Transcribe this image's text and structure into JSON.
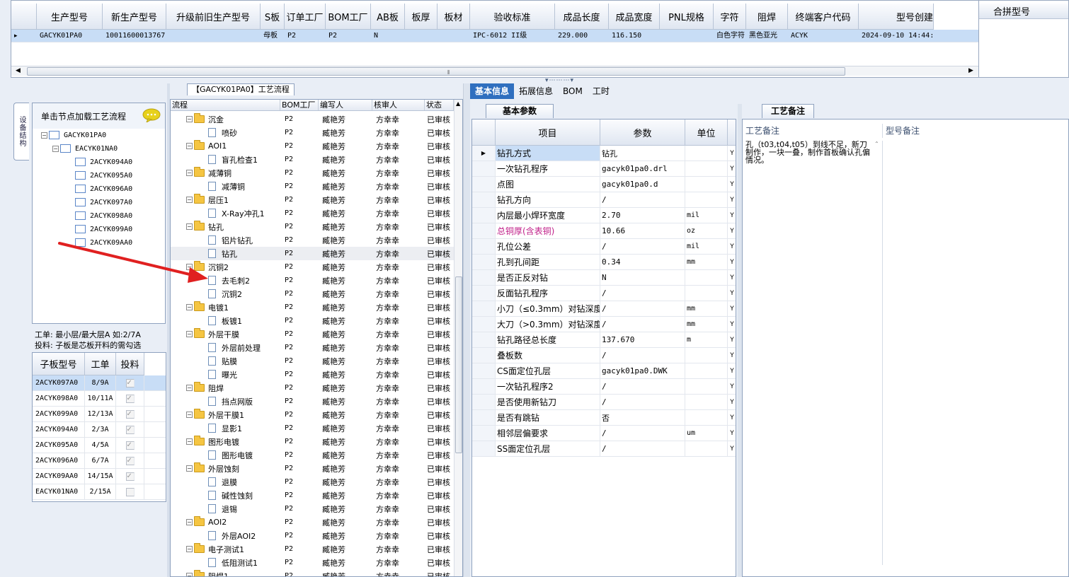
{
  "top_grid": {
    "columns": [
      "生产型号",
      "新生产型号",
      "升级前旧生产型号",
      "S板",
      "订单工厂",
      "BOM工厂",
      "AB板",
      "板厚",
      "板材",
      "验收标准",
      "成品长度",
      "成品宽度",
      "PNL规格",
      "字符",
      "阻焊",
      "终端客户代码",
      "型号创建"
    ],
    "row": [
      "GACYK01PA0",
      "10011600013767",
      "",
      "母板",
      "P2",
      "P2",
      "N",
      "",
      "",
      "IPC-6012 II级",
      "229.000",
      "116.150",
      "",
      "白色字符",
      "黑色亚光",
      "ACYK",
      "2024-09-10 14:44:"
    ],
    "merge_header": "合拼型号"
  },
  "left_panel": {
    "side_tab": "设备结构",
    "tree_hint": "单击节点加载工艺流程",
    "tree": {
      "root": "GACYK01PA0",
      "child": "EACYK01NA0",
      "leaves": [
        "2ACYK094A0",
        "2ACYK095A0",
        "2ACYK096A0",
        "2ACYK097A0",
        "2ACYK098A0",
        "2ACYK099A0",
        "2ACYK09AA0"
      ]
    },
    "note_line1": "工单: 最小层/最大层A 如:2/7A",
    "note_line2": "投料: 子板是芯板开料的需勾选",
    "sub_grid": {
      "headers": [
        "子板型号",
        "工单",
        "投料"
      ],
      "rows": [
        {
          "model": "2ACYK097A0",
          "order": "8/9A",
          "checked": true
        },
        {
          "model": "2ACYK098A0",
          "order": "10/11A",
          "checked": true
        },
        {
          "model": "2ACYK099A0",
          "order": "12/13A",
          "checked": true
        },
        {
          "model": "2ACYK094A0",
          "order": "2/3A",
          "checked": true
        },
        {
          "model": "2ACYK095A0",
          "order": "4/5A",
          "checked": true
        },
        {
          "model": "2ACYK096A0",
          "order": "6/7A",
          "checked": true
        },
        {
          "model": "2ACYK09AA0",
          "order": "14/15A",
          "checked": true
        },
        {
          "model": "EACYK01NA0",
          "order": "2/15A",
          "checked": false
        }
      ],
      "check_glyph": "✓"
    }
  },
  "flow_panel": {
    "title": "【GACYK01PA0】工艺流程",
    "headers": [
      "流程",
      "BOM工厂",
      "编写人",
      "核审人",
      "状态"
    ],
    "bom": "P2",
    "writer": "臧艳芳",
    "reviewer": "方幸幸",
    "status": "已审核",
    "rows": [
      {
        "t": "f",
        "n": "沉金"
      },
      {
        "t": "d",
        "n": "喷砂"
      },
      {
        "t": "f",
        "n": "AOI1"
      },
      {
        "t": "d",
        "n": "盲孔检查1"
      },
      {
        "t": "f",
        "n": "减薄铜"
      },
      {
        "t": "d",
        "n": "减薄铜"
      },
      {
        "t": "f",
        "n": "层压1"
      },
      {
        "t": "d",
        "n": "X-Ray冲孔1"
      },
      {
        "t": "f",
        "n": "钻孔"
      },
      {
        "t": "d",
        "n": "铝片钻孔"
      },
      {
        "t": "d",
        "n": "钻孔",
        "sel": true
      },
      {
        "t": "f",
        "n": "沉铜2"
      },
      {
        "t": "d",
        "n": "去毛刺2"
      },
      {
        "t": "d",
        "n": "沉铜2"
      },
      {
        "t": "f",
        "n": "电镀1"
      },
      {
        "t": "d",
        "n": "板镀1"
      },
      {
        "t": "f",
        "n": "外层干膜"
      },
      {
        "t": "d",
        "n": "外层前处理"
      },
      {
        "t": "d",
        "n": "贴膜"
      },
      {
        "t": "d",
        "n": "曝光"
      },
      {
        "t": "f",
        "n": "阻焊"
      },
      {
        "t": "d",
        "n": "挡点网版"
      },
      {
        "t": "f",
        "n": "外层干膜1"
      },
      {
        "t": "d",
        "n": "显影1"
      },
      {
        "t": "f",
        "n": "图形电镀"
      },
      {
        "t": "d",
        "n": "图形电镀"
      },
      {
        "t": "f",
        "n": "外层蚀刻"
      },
      {
        "t": "d",
        "n": "退膜"
      },
      {
        "t": "d",
        "n": "碱性蚀刻"
      },
      {
        "t": "d",
        "n": "退锡"
      },
      {
        "t": "f",
        "n": "AOI2"
      },
      {
        "t": "d",
        "n": "外层AOI2"
      },
      {
        "t": "f",
        "n": "电子测试1"
      },
      {
        "t": "d",
        "n": "低阻测试1"
      },
      {
        "t": "f",
        "n": "阻焊1"
      }
    ]
  },
  "right_panel": {
    "tabs": [
      "基本信息",
      "拓展信息",
      "BOM",
      "工时"
    ],
    "active_tab": "基本信息",
    "sub_tab": "基本参数",
    "param_headers": [
      "项目",
      "参数",
      "单位"
    ],
    "params": [
      {
        "name": "钻孔方式",
        "value": "钻孔",
        "unit": "",
        "hl": true
      },
      {
        "name": "一次钻孔程序",
        "value": "gacyk01pa0.drl",
        "unit": ""
      },
      {
        "name": "点图",
        "value": "gacyk01pa0.d",
        "unit": ""
      },
      {
        "name": "钻孔方向",
        "value": "/",
        "unit": ""
      },
      {
        "name": "内层最小焊环宽度",
        "value": "2.70",
        "unit": "mil"
      },
      {
        "name": "总铜厚(含表铜)",
        "value": "10.66",
        "unit": "oz",
        "pink": true
      },
      {
        "name": "孔位公差",
        "value": "/",
        "unit": "mil"
      },
      {
        "name": "孔到孔间距",
        "value": "0.34",
        "unit": "mm"
      },
      {
        "name": "是否正反对钻",
        "value": "N",
        "unit": ""
      },
      {
        "name": "反面钻孔程序",
        "value": "/",
        "unit": ""
      },
      {
        "name": "小刀（≤0.3mm）对钻深度",
        "value": "/",
        "unit": "mm"
      },
      {
        "name": "大刀（>0.3mm）对钻深度",
        "value": "/",
        "unit": "mm"
      },
      {
        "name": "钻孔路径总长度",
        "value": "137.670",
        "unit": "m"
      },
      {
        "name": "叠板数",
        "value": "/",
        "unit": ""
      },
      {
        "name": "CS面定位孔层",
        "value": "gacyk01pa0.DWK",
        "unit": ""
      },
      {
        "name": "一次钻孔程序2",
        "value": "/",
        "unit": ""
      },
      {
        "name": "是否使用新钻刀",
        "value": "/",
        "unit": ""
      },
      {
        "name": "是否有跳钻",
        "value": "否",
        "unit": ""
      },
      {
        "name": "相邻层偏要求",
        "value": "/",
        "unit": "um"
      },
      {
        "name": "SS面定位孔层",
        "value": "/",
        "unit": ""
      }
    ],
    "extra_col": "Y",
    "remark_tab": "工艺备注",
    "remark_headers": [
      "工艺备注",
      "型号备注"
    ],
    "remark_text": "孔（t03,t04,t05）到线不足，新刀制作，一块一叠，制作首板确认孔偏情况。"
  },
  "colors": {
    "accent": "#2f6fbf",
    "selected_row": "#c8ddf6",
    "arrow": "#e02020",
    "pink_text": "#c0208a"
  }
}
